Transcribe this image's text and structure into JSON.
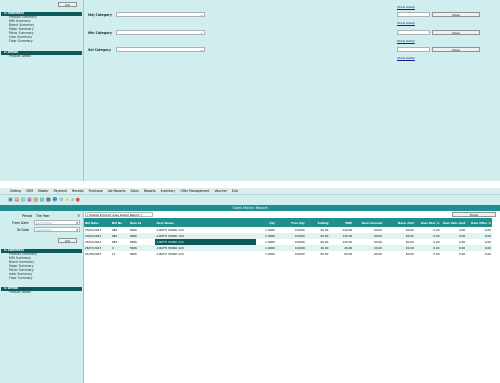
{
  "top": {
    "go_label": "GO",
    "summary_label": "Summary",
    "summary_items": [
      "Product Summary",
      "MRI Summary",
      "Brand Summary",
      "Major Summary",
      "Minor Summary",
      "Intar Summary",
      "Floor Summary"
    ],
    "detail_label": "Detail",
    "detail_items": [
      "Product Detail"
    ],
    "filters": [
      {
        "label": "Maj Category"
      },
      {
        "label": "Min Category"
      },
      {
        "label": "Sel Category"
      }
    ],
    "clear_label": "Clear",
    "show_detail": "Show Detail"
  },
  "bottom": {
    "menu": [
      "Setting",
      "CRM",
      "Master",
      "Payment",
      "Receipt",
      "Purchase",
      "Ast Reports",
      "Sales",
      "Reports",
      "Inventory",
      "Offer Management",
      "Voucher",
      "Exit"
    ],
    "title": "Sales Matrix Report",
    "period_label": "Period",
    "period_value": "The Year",
    "from_label": "From Date",
    "from_value": "01/07/2022",
    "to_label": "To Date",
    "to_value": "30/06/2023",
    "go_label": "GO",
    "summary_label": "Summary",
    "summary_items": [
      "Product Summary",
      "MRI Summary",
      "Brand Summary",
      "Major Summary",
      "Minor Summary",
      "Intar Summary",
      "Floor Summary"
    ],
    "detail_label": "Detail",
    "detail_items": [
      "Product Detail"
    ],
    "breadcrumb": "( Mobile Product wise Detail Report )",
    "export_label": "Excel",
    "table": {
      "columns": [
        "Bill Date",
        "Bill No",
        "Item Id",
        "Item Name",
        "Qty",
        "Free Qty",
        "Selling",
        "MRP",
        "Item Amount",
        "Basic Amt",
        "Item Disc %",
        "Item Disc Amt",
        "Item Offer %"
      ],
      "rows": [
        [
          "23/02/2023",
          "982",
          "3666",
          "A BATTI STAND 120",
          "1.0000",
          "0.0000",
          "60.00",
          "120.00",
          "60.00",
          "60.00",
          "0.00",
          "0.00",
          "0.00"
        ],
        [
          "23/02/2023",
          "982",
          "3666",
          "A BATTI STAND 120",
          "1.0000",
          "0.0000",
          "60.00",
          "120.00",
          "60.00",
          "60.00",
          "0.00",
          "0.00",
          "0.00"
        ],
        [
          "24/02/2023",
          "984",
          "3666",
          "A BATTI STAND 120",
          "1.0000",
          "0.0000",
          "60.00",
          "120.00",
          "60.00",
          "60.00",
          "0.00",
          "0.00",
          "0.00"
        ],
        [
          "28/07/2023",
          "4",
          "3666",
          "A BATTI STAND 120",
          "1.0000",
          "0.0000",
          "20.00",
          "20.00",
          "20.00",
          "20.00",
          "0.00",
          "0.00",
          "0.00"
        ],
        [
          "01/08/2023",
          "17",
          "3666",
          "A BATTI STAND 120",
          "1.0000",
          "0.0000",
          "60.00",
          "60.00",
          "60.00",
          "60.00",
          "0.00",
          "0.00",
          "0.00"
        ]
      ],
      "selected_row": 2
    }
  },
  "colors": {
    "teal_bg": "#cfeeed",
    "dark_teal": "#0d5a5a",
    "header_teal": "#1f8f8f",
    "selected": "#0d5a5a",
    "row_alt": "#dff3f2"
  }
}
